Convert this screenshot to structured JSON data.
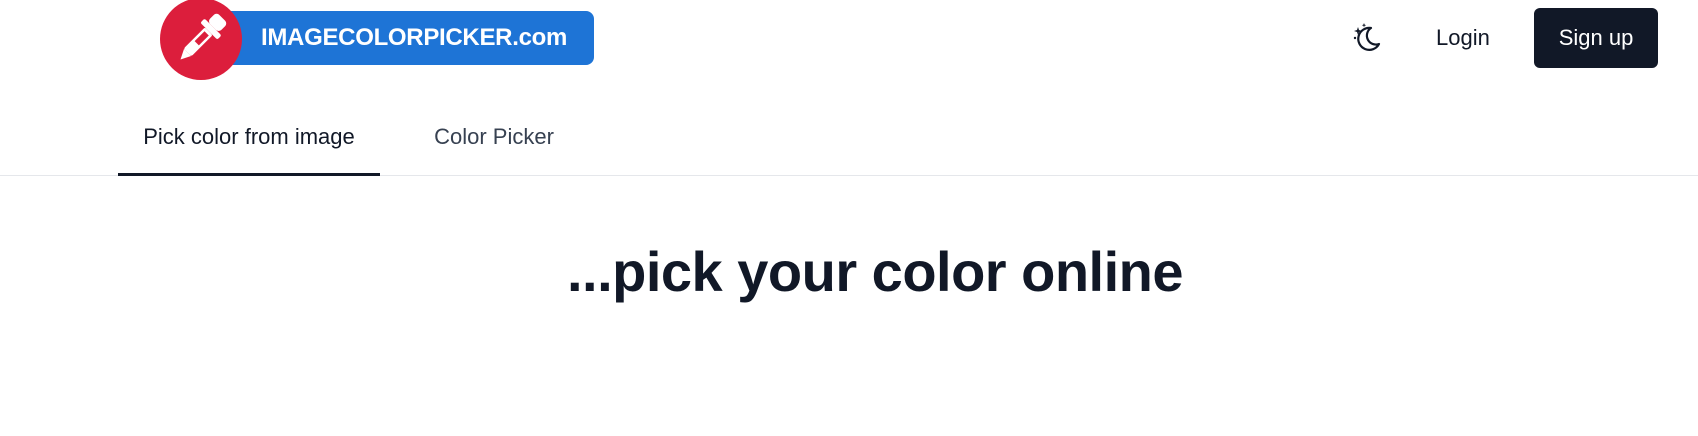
{
  "brand": {
    "name": "IMAGECOLORPICKER.com",
    "logo_icon": "eyedropper-icon",
    "circle_color": "#dc1e3c",
    "pill_color": "#1e74d6"
  },
  "header": {
    "theme_toggle_icon": "moon-stars-icon",
    "login_label": "Login",
    "signup_label": "Sign up"
  },
  "tabs": [
    {
      "label": "Pick color from image",
      "active": true
    },
    {
      "label": "Color Picker",
      "active": false
    }
  ],
  "hero": {
    "title": "...pick your color online"
  },
  "colors": {
    "text_dark": "#111827",
    "tab_border": "#e5e7eb"
  }
}
